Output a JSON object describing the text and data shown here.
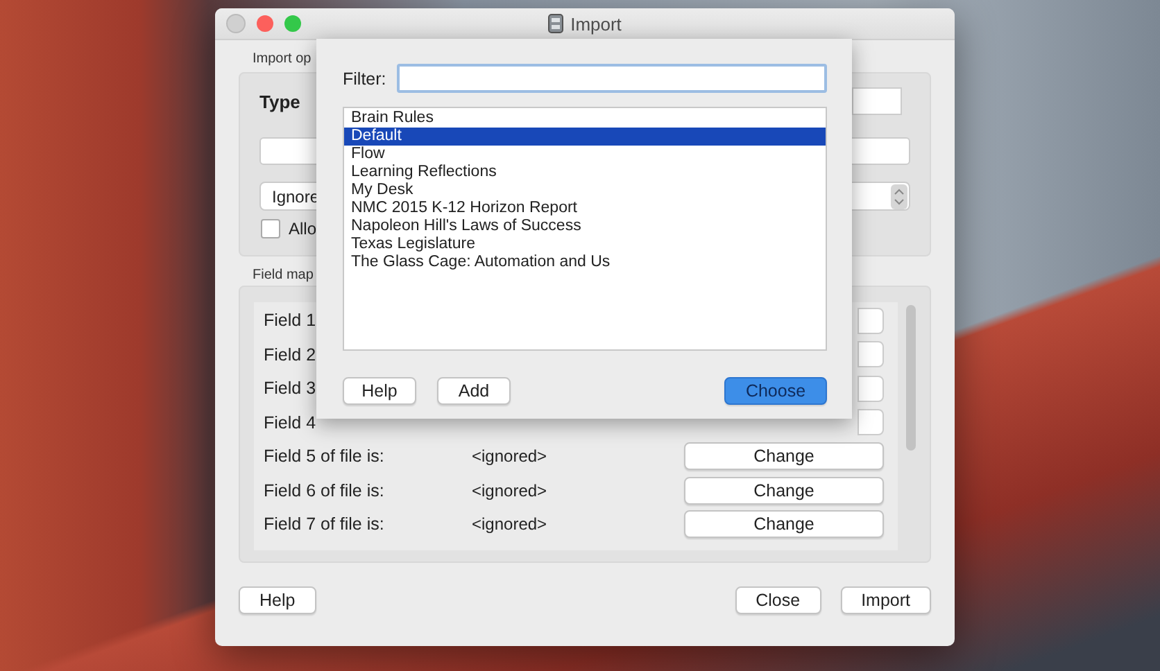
{
  "window": {
    "title": "Import"
  },
  "import_options": {
    "label": "Import op",
    "type_label": "Type",
    "popup_value": "Ignore",
    "checkbox": {
      "label": "Allo",
      "checked": false
    }
  },
  "field_mapping": {
    "label": "Field map",
    "rows": [
      {
        "kind": "covered",
        "label": "Field 1"
      },
      {
        "kind": "covered",
        "label": "Field 2"
      },
      {
        "kind": "covered",
        "label": "Field 3"
      },
      {
        "kind": "covered",
        "label": "Field 4"
      },
      {
        "kind": "full",
        "label": "Field 5 of file is:",
        "value": "<ignored>",
        "button": "Change"
      },
      {
        "kind": "full",
        "label": "Field 6 of file is:",
        "value": "<ignored>",
        "button": "Change"
      },
      {
        "kind": "full",
        "label": "Field 7 of file is:",
        "value": "<ignored>",
        "button": "Change"
      }
    ]
  },
  "footer": {
    "help": "Help",
    "close": "Close",
    "import": "Import"
  },
  "sheet": {
    "filter_label": "Filter:",
    "items": [
      {
        "label": "Brain Rules",
        "selected": false
      },
      {
        "label": "Default",
        "selected": true
      },
      {
        "label": "Flow",
        "selected": false
      },
      {
        "label": "Learning Reflections",
        "selected": false
      },
      {
        "label": "My Desk",
        "selected": false
      },
      {
        "label": "NMC 2015 K-12 Horizon Report",
        "selected": false
      },
      {
        "label": "Napoleon Hill's Laws of Success",
        "selected": false
      },
      {
        "label": "Texas Legislature",
        "selected": false
      },
      {
        "label": "The Glass Cage: Automation and Us",
        "selected": false
      }
    ],
    "buttons": {
      "help": "Help",
      "add": "Add",
      "choose": "Choose"
    }
  }
}
